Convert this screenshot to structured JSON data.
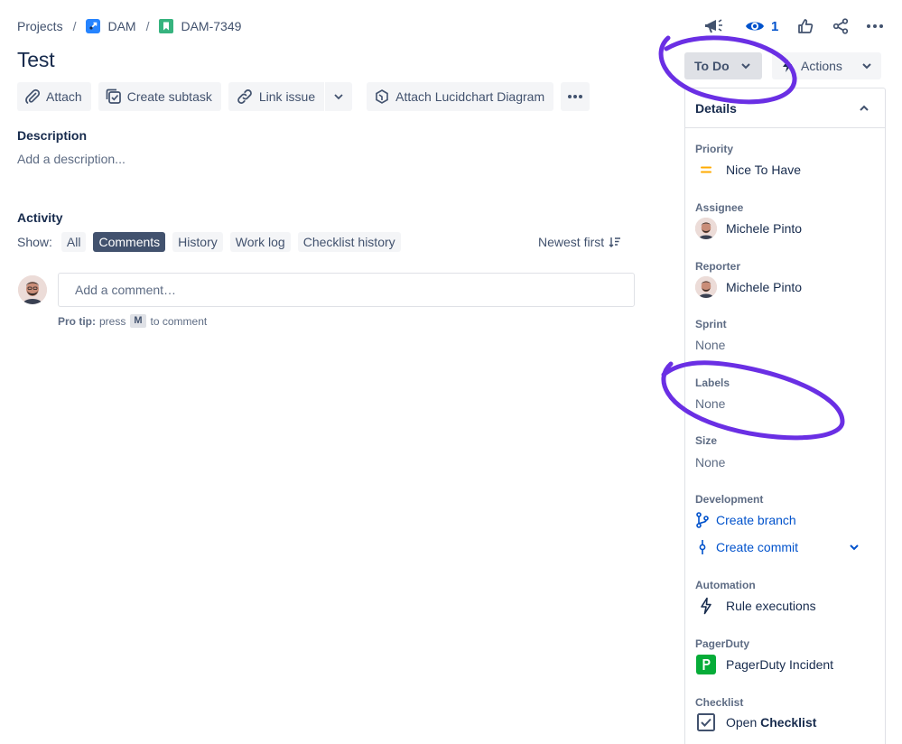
{
  "breadcrumb": {
    "projects": "Projects",
    "project": "DAM",
    "issue": "DAM-7349",
    "sep": "/"
  },
  "header": {
    "title": "Test",
    "watch_count": "1"
  },
  "toolbar": {
    "attach": "Attach",
    "create_subtask": "Create subtask",
    "link_issue": "Link issue",
    "lucidchart": "Attach Lucidchart Diagram"
  },
  "description": {
    "title": "Description",
    "placeholder": "Add a description..."
  },
  "activity": {
    "title": "Activity",
    "show_label": "Show:",
    "filters": [
      "All",
      "Comments",
      "History",
      "Work log",
      "Checklist history"
    ],
    "active_filter": "Comments",
    "sort": "Newest first",
    "comment_placeholder": "Add a comment…",
    "pro_tip_bold": "Pro tip:",
    "pro_tip_press": "press",
    "pro_tip_key": "M",
    "pro_tip_suffix": "to comment"
  },
  "status": {
    "label": "To Do",
    "actions": "Actions"
  },
  "details": {
    "title": "Details",
    "priority_label": "Priority",
    "priority_value": "Nice To Have",
    "assignee_label": "Assignee",
    "assignee_value": "Michele Pinto",
    "reporter_label": "Reporter",
    "reporter_value": "Michele Pinto",
    "sprint_label": "Sprint",
    "sprint_value": "None",
    "labels_label": "Labels",
    "labels_value": "None",
    "size_label": "Size",
    "size_value": "None",
    "development_label": "Development",
    "create_branch": "Create branch",
    "create_commit": "Create commit",
    "automation_label": "Automation",
    "rule_executions": "Rule executions",
    "pagerduty_label": "PagerDuty",
    "pagerduty_value": "PagerDuty Incident",
    "checklist_label": "Checklist",
    "checklist_open": "Open",
    "checklist_bold": "Checklist"
  },
  "colors": {
    "accent": "#0052cc",
    "annotation": "#6a2fe4",
    "priority": "#ffab00",
    "pagerduty": "#06ac38",
    "project_icon": "#2684ff",
    "issue_icon": "#36b37e"
  }
}
